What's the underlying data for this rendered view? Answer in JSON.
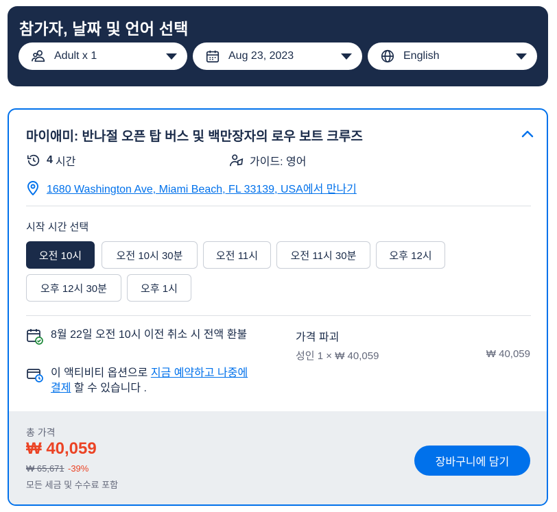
{
  "header": {
    "title": "참가자, 날짜 및 언어 선택",
    "participants": {
      "label": "Adult x 1",
      "icon": "participants-icon"
    },
    "date": {
      "label": "Aug 23, 2023",
      "icon": "calendar-icon"
    },
    "language": {
      "label": "English",
      "icon": "globe-icon"
    }
  },
  "card": {
    "title": "마이애미: 반나절 오픈 탑 버스 및 백만장자의 로우 보트 크루즈",
    "duration_value": "4",
    "duration_unit": "시간",
    "guide": "가이드: 영어",
    "meeting_address": "1680 Washington Ave, Miami Beach, FL 33139, USA",
    "meeting_suffix": "에서 만나기",
    "start_time_label": "시작 시간 선택",
    "time_slots": [
      "오전 10시",
      "오전 10시 30분",
      "오전 11시",
      "오전 11시 30분",
      "오후 12시",
      "오후 12시 30분",
      "오후 1시"
    ],
    "selected_slot": "오전 10시",
    "cancellation": "8월 22일 오전 10시 이전 취소 시 전액 환불",
    "reserve_prefix": "이 액티비티 옵션으로 ",
    "reserve_link": "지금 예약하고 나중에 결제",
    "reserve_suffix": " 할 수 있습니다 .",
    "breakdown_title": "가격 파괴",
    "breakdown_line": "성인 1 × ₩ 40,059",
    "breakdown_amount": "₩ 40,059"
  },
  "footer": {
    "total_label": "총 가격",
    "total_price": "₩ 40,059",
    "old_price": "₩ 65,671",
    "discount": "-39%",
    "tax_note": "모든 세금 및 수수료 포함",
    "cart_button": "장바구니에 담기"
  },
  "colors": {
    "navy": "#1a2b49",
    "accent": "#0071eb",
    "price_red": "#eb4325",
    "footer_bg": "#ebeef1"
  }
}
